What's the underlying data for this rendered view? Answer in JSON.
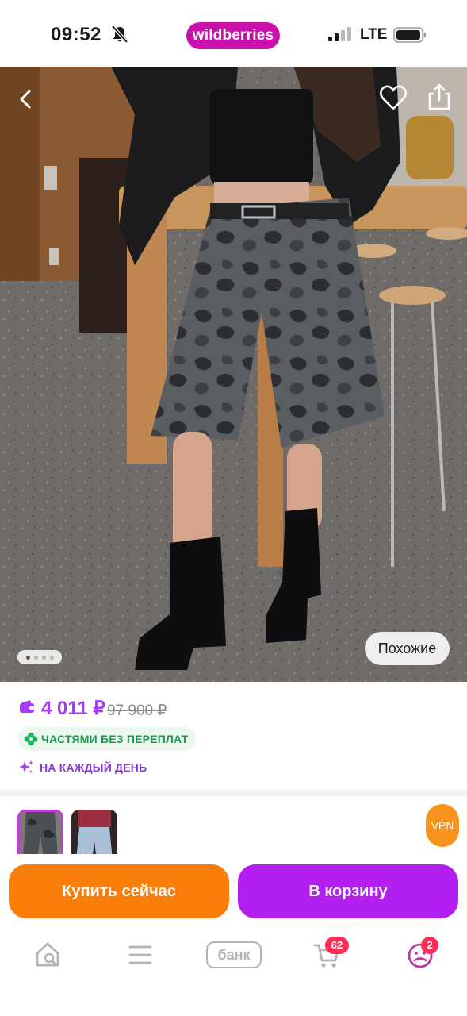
{
  "status_bar": {
    "time": "09:52",
    "network": "LTE",
    "brand": "wildberries"
  },
  "product_image": {
    "description_icon_names": [
      "back-arrow-icon",
      "heart-icon",
      "share-icon"
    ],
    "similar_label": "Похожие",
    "carousel_total": 4,
    "carousel_active": 1
  },
  "price": {
    "current": "4 011 ₽",
    "old": "97 900 ₽",
    "color": "#a73afd"
  },
  "promo": {
    "installment": "ЧАСТЯМИ БЕЗ ПЕРЕПЛАТ",
    "everyday": "НА КАЖДЫЙ ДЕНЬ"
  },
  "vpn_badge": "VPN",
  "actions": {
    "buy_now": "Купить сейчас",
    "add_to_cart": "В корзину",
    "buy_color": "#fb7d0a",
    "cart_color": "#b21ff0"
  },
  "nav": {
    "bank_label": "банк",
    "cart_badge": "62",
    "profile_badge": "2"
  }
}
